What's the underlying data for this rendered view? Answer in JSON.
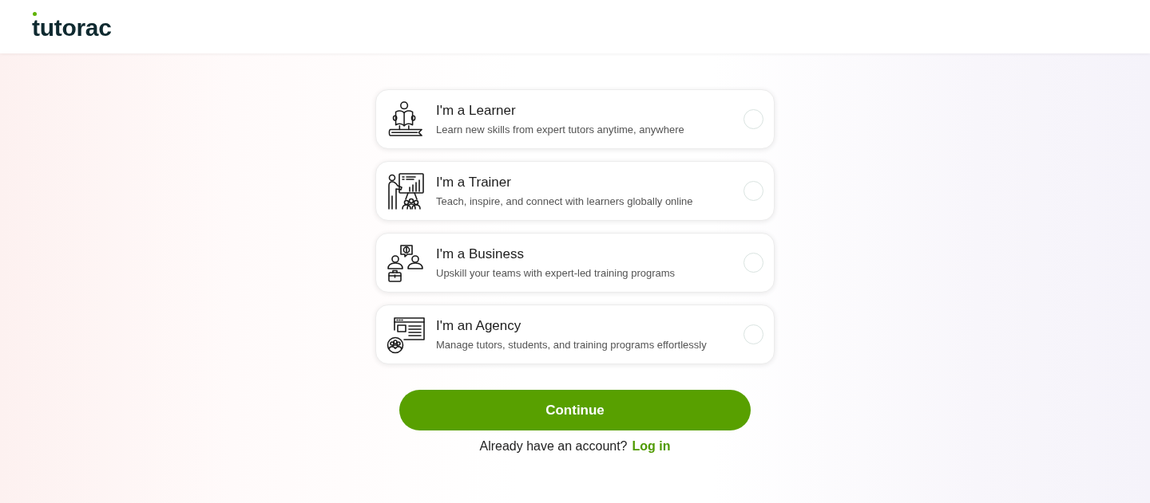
{
  "header": {
    "logo": "tutorac"
  },
  "roles": [
    {
      "kind": "learner",
      "title": "I'm a Learner",
      "description": "Learn new skills from expert tutors anytime, anywhere",
      "selected": false
    },
    {
      "kind": "trainer",
      "title": "I'm a Trainer",
      "description": "Teach, inspire, and connect with learners globally online",
      "selected": false
    },
    {
      "kind": "business",
      "title": "I'm a Business",
      "description": "Upskill your teams with expert-led training programs",
      "selected": false
    },
    {
      "kind": "agency",
      "title": "I'm an Agency",
      "description": "Manage tutors, students, and training programs effortlessly",
      "selected": false
    }
  ],
  "continue_button": "Continue",
  "login_prompt": {
    "text": "Already have an account?",
    "link": "Log in"
  }
}
